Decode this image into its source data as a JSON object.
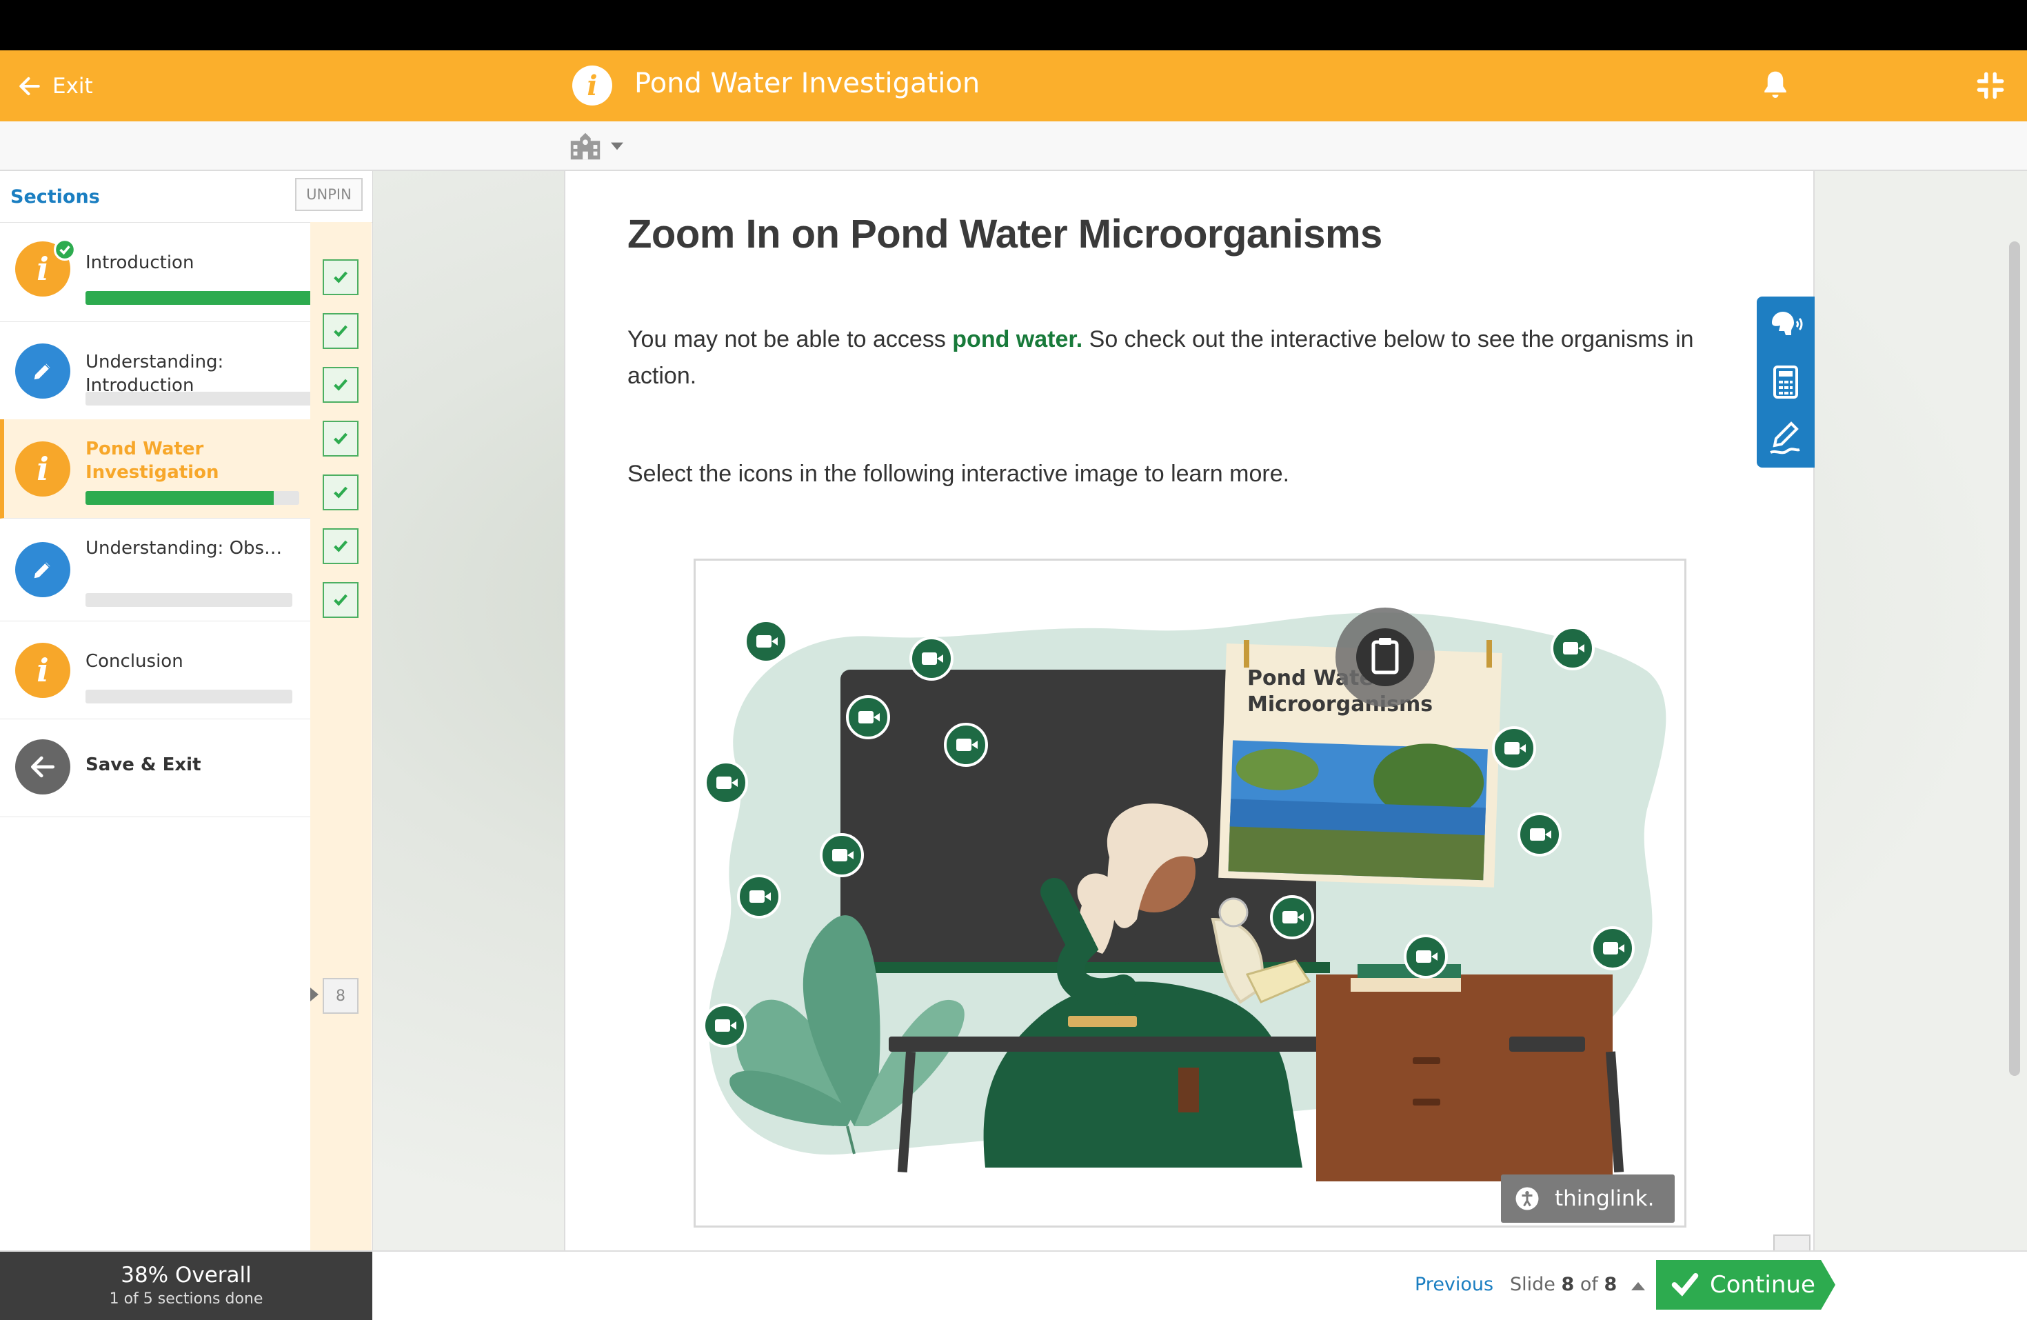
{
  "header": {
    "exit_label": "Exit",
    "title": "Pond Water Investigation",
    "info_icon": "info-icon",
    "bell_icon": "bell-icon",
    "exit_fullscreen_icon": "compress-icon"
  },
  "toolbar": {
    "school_icon": "school-icon"
  },
  "sidebar": {
    "heading": "Sections",
    "unpin_label": "UNPIN",
    "items": [
      {
        "label": "Introduction",
        "icon": "info-icon",
        "progress": 1.0,
        "completed": true
      },
      {
        "label": "Understanding: Introduction",
        "icon": "pencil-icon",
        "progress": 0
      },
      {
        "label": "Pond Water Investigation",
        "icon": "info-icon",
        "progress": 0.88,
        "active": true
      },
      {
        "label": "Understanding: Observing Single-cell…",
        "icon": "pencil-icon",
        "progress": 0
      },
      {
        "label": "Conclusion",
        "icon": "info-icon",
        "progress": 0
      },
      {
        "label": "Save & Exit",
        "icon": "arrow-left-icon"
      }
    ],
    "slide_checks": 7,
    "more_count": "8"
  },
  "content": {
    "title": "Zoom In on Pond Water Microorganisms",
    "para1_a": "You may not be able to access ",
    "para1_link": "pond water.",
    "para1_b": " So check out the interactive below to see the organisms in action.",
    "para2": "Select the icons in the following interactive image to learn more.",
    "poster_title_1": "Pond Water",
    "poster_title_2": "Microorganisms",
    "thinglink_label": "thinglink.",
    "accent_green": "#187a3a"
  },
  "footer": {
    "overall": "38% Overall",
    "sections_done": "1 of 5 sections done",
    "previous": "Previous",
    "slide_prefix": "Slide ",
    "slide_current": "8",
    "slide_of": " of ",
    "slide_total": "8",
    "continue": "Continue"
  },
  "colors": {
    "header": "#fbaf2c",
    "link_blue": "#1a7ec1",
    "progress_green": "#2dab4f",
    "tool_blue": "#1e7ec2"
  }
}
